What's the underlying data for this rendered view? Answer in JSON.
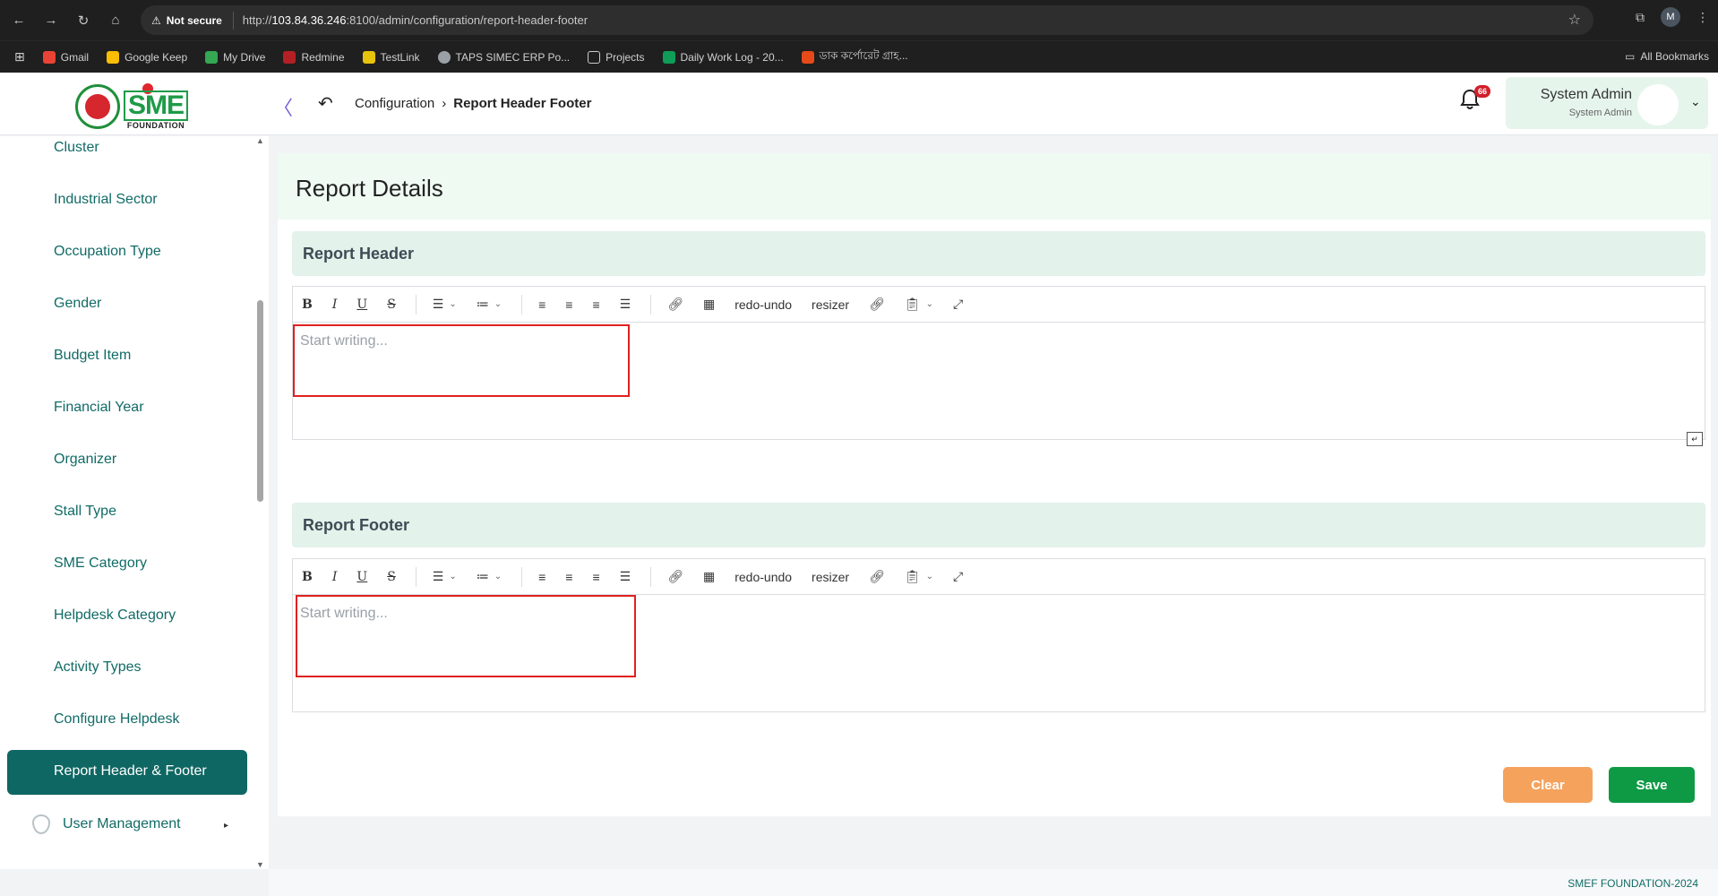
{
  "browser": {
    "security_label": "Not secure",
    "url_prefix": "http://",
    "url_host": "103.84.36.246",
    "url_rest": ":8100/admin/configuration/report-header-footer",
    "profile_initial": "M",
    "bookmarks": [
      "Gmail",
      "Google Keep",
      "My Drive",
      "Redmine",
      "TestLink",
      "TAPS SIMEC ERP Po...",
      "Projects",
      "Daily Work Log - 20...",
      "ডাক কর্পোরেট গ্রাহ..."
    ],
    "all_bookmarks": "All Bookmarks"
  },
  "header": {
    "logo_text": "SME",
    "logo_sub": "FOUNDATION",
    "breadcrumb_parent": "Configuration",
    "breadcrumb_current": "Report Header Footer",
    "notification_count": "66",
    "user_name": "System Admin",
    "user_role": "System Admin"
  },
  "sidebar": {
    "items": [
      {
        "label": "Cluster"
      },
      {
        "label": "Industrial Sector"
      },
      {
        "label": "Occupation Type"
      },
      {
        "label": "Gender"
      },
      {
        "label": "Budget Item"
      },
      {
        "label": "Financial Year"
      },
      {
        "label": "Organizer"
      },
      {
        "label": "Stall Type"
      },
      {
        "label": "SME Category"
      },
      {
        "label": "Helpdesk Category"
      },
      {
        "label": "Activity Types"
      },
      {
        "label": "Configure Helpdesk"
      }
    ],
    "active_item": "Report Header & Footer",
    "user_management": "User Management"
  },
  "main": {
    "title": "Report Details",
    "header_section": "Report Header",
    "footer_section": "Report Footer",
    "editor_placeholder": "Start writing...",
    "toolbar": {
      "bold": "B",
      "italic": "I",
      "underline": "U",
      "strike": "S",
      "redo_undo": "redo-undo",
      "resizer": "resizer"
    },
    "clear_label": "Clear",
    "save_label": "Save"
  },
  "footer": {
    "text": "SMEF FOUNDATION-2024"
  }
}
